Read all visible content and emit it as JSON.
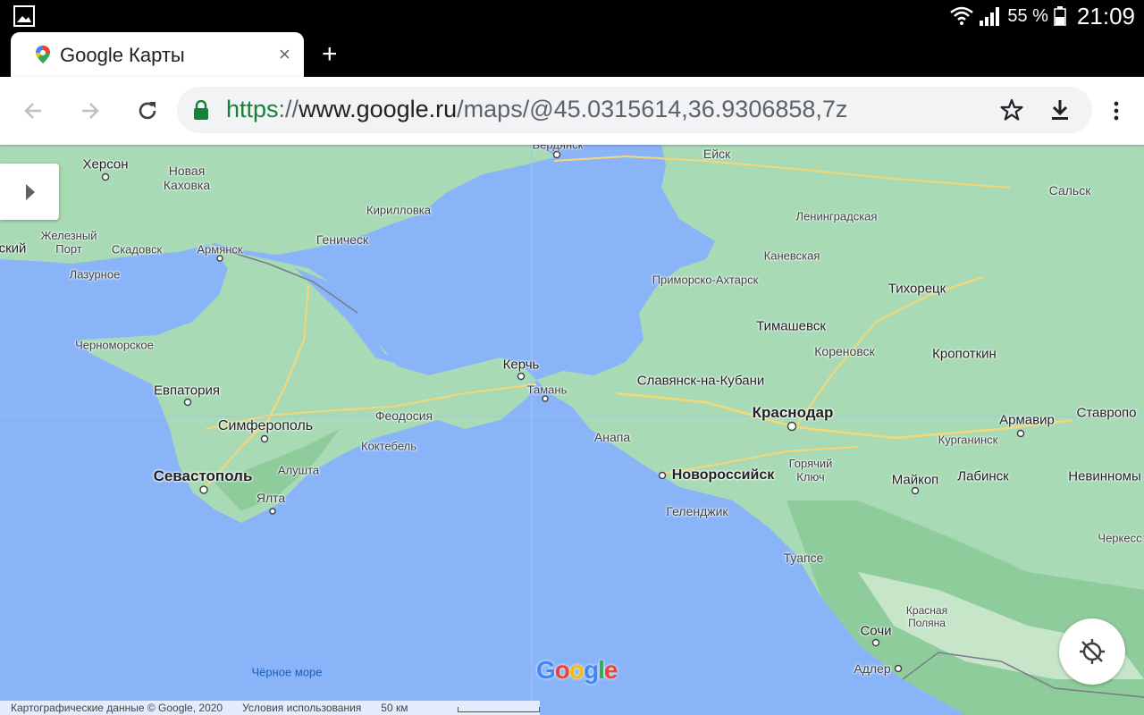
{
  "status_bar": {
    "battery": "55 %",
    "time": "21:09"
  },
  "tab": {
    "title": "Google Карты",
    "close_symbol": "×",
    "new_tab_symbol": "+"
  },
  "toolbar": {
    "url_scheme": "https",
    "url_sep": "://",
    "url_host": "www.google.ru",
    "url_path": "/maps/@45.0315614,36.9306858,7z"
  },
  "map": {
    "labels": {
      "kherson": "Херсон",
      "novaya_kakhovka": "Новая\nКаховка",
      "berdyansk": "Бердянск",
      "yeysk": "Ейск",
      "salsk": "Сальск",
      "kirillovka": "Кирилловка",
      "leningradskaya": "Ленинградская",
      "zhelezny_port": "Железный\nПорт",
      "skadovsk": "Скадовск",
      "armyansk": "Армянск",
      "genichesk": "Геническ",
      "lazurnoe": "Лазурное",
      "skiy": "ский",
      "kanevskaya": "Каневская",
      "primorsko": "Приморско-Ахтарск",
      "tikhoretsk": "Тихорецк",
      "chernomorskoe": "Черноморское",
      "timashevsk": "Тимашевск",
      "korenovsk": "Кореновск",
      "kropotkin": "Кропоткин",
      "kerch": "Керчь",
      "taman": "Тамань",
      "evpatoria": "Евпатория",
      "slavyansk": "Славянск-на-Кубани",
      "krasnodar": "Краснодар",
      "armavir": "Армавир",
      "stavropol": "Ставропо",
      "feodosia": "Феодосия",
      "simferopol": "Симферополь",
      "anapa": "Анапа",
      "kurganinsk": "Курганинск",
      "koktebel": "Коктебель",
      "alushta": "Алушта",
      "sevastopol": "Севастополь",
      "novorossiysk": "Новороссийск",
      "goryachiy": "Горячий\nКлюч",
      "maykop": "Майкоп",
      "labinsk": "Лабинск",
      "nevinnomysk": "Невинномы",
      "yalta": "Ялта",
      "gelendzhik": "Геленджик",
      "cherkessk": "Черкесс",
      "tuapse": "Туапсе",
      "krasnaya_polyana": "Красная\nПоляна",
      "sochi": "Сочи",
      "adler": "Адлер",
      "black_sea": "Чёрное море"
    },
    "attribution": {
      "data": "Картографические данные © Google, 2020",
      "terms": "Условия использования",
      "scale": "50 км"
    },
    "logo": "Google"
  }
}
